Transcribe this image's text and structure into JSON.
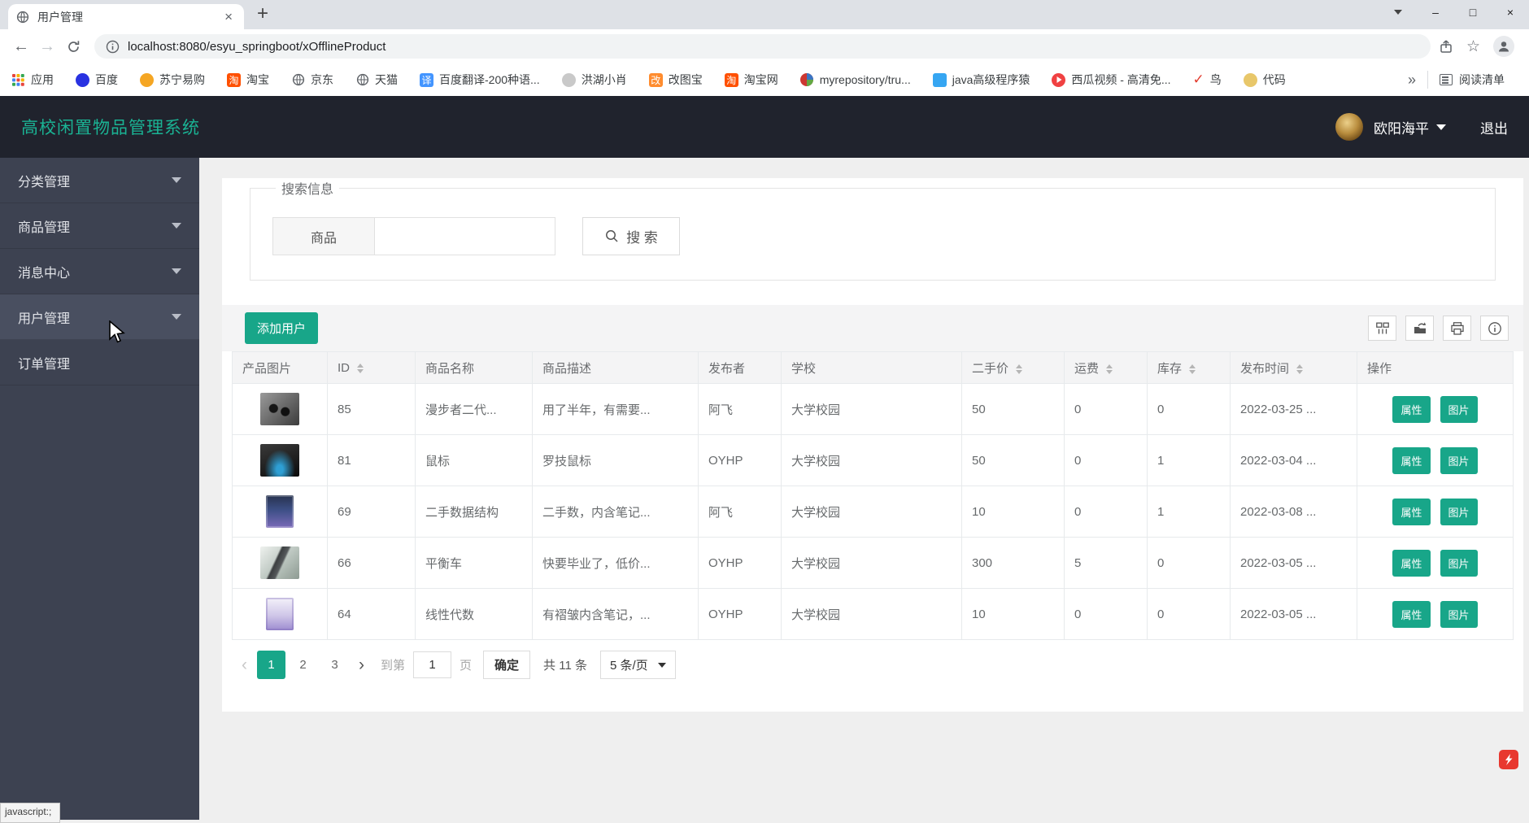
{
  "colors": {
    "accent": "#1ab394",
    "accent_dark": "#18a689",
    "header_bg": "#20232d",
    "sidebar_bg": "#3d4251",
    "sidebar_active_bg": "#494f60",
    "page_bg": "#efefef"
  },
  "browser": {
    "tab_title": "用户管理",
    "url": "localhost:8080/esyu_springboot/xOfflineProduct",
    "bookmarks": [
      {
        "label": "应用",
        "icon": "apps-grid-icon",
        "type": "grid"
      },
      {
        "label": "百度",
        "icon": "baidu-icon",
        "type": "dot",
        "color": "#2932e1"
      },
      {
        "label": "苏宁易购",
        "icon": "suning-icon",
        "type": "dot",
        "color": "#f5a623"
      },
      {
        "label": "淘宝",
        "icon": "taobao-icon",
        "type": "char",
        "color": "#ff5000",
        "glyph": "淘"
      },
      {
        "label": "京东",
        "icon": "jd-globe-icon",
        "type": "globe"
      },
      {
        "label": "天猫",
        "icon": "tmall-globe-icon",
        "type": "globe"
      },
      {
        "label": "百度翻译-200种语...",
        "icon": "baidu-translate-icon",
        "type": "char",
        "color": "#4395ff",
        "glyph": "译"
      },
      {
        "label": "洪湖小肖",
        "icon": "honghu-icon",
        "type": "dot",
        "color": "#c9c9c9"
      },
      {
        "label": "改图宝",
        "icon": "gaitubao-icon",
        "type": "char",
        "color": "#ff8c2e",
        "glyph": "改"
      },
      {
        "label": "淘宝网",
        "icon": "taobaowang-icon",
        "type": "char",
        "color": "#ff5000",
        "glyph": "淘"
      },
      {
        "label": "myrepository/tru...",
        "icon": "maven-repo-icon",
        "type": "multidot"
      },
      {
        "label": "java高级程序猿",
        "icon": "java-robot-icon",
        "type": "char",
        "color": "#36a6f2",
        "glyph": ""
      },
      {
        "label": "西瓜视频 - 高清免...",
        "icon": "xigua-video-icon",
        "type": "play",
        "color": "#f04142"
      },
      {
        "label": "鸟",
        "icon": "bird-icon",
        "type": "check",
        "color": "#e23b2e"
      },
      {
        "label": "代码",
        "icon": "code-icon",
        "type": "dot",
        "color": "#e8c76a"
      }
    ],
    "overflow_chevron": "»",
    "reading_list_label": "阅读清单"
  },
  "header": {
    "title": "高校闲置物品管理系统",
    "username": "欧阳海平",
    "logout_label": "退出"
  },
  "sidebar": {
    "items": [
      {
        "label": "分类管理",
        "chevron": true,
        "active": false
      },
      {
        "label": "商品管理",
        "chevron": true,
        "active": false
      },
      {
        "label": "消息中心",
        "chevron": true,
        "active": false
      },
      {
        "label": "用户管理",
        "chevron": true,
        "active": true
      },
      {
        "label": "订单管理",
        "chevron": false,
        "active": false
      }
    ]
  },
  "search": {
    "legend": "搜索信息",
    "field_label": "商品",
    "input_value": "",
    "button_label": "搜 索"
  },
  "toolbar": {
    "add_button_label": "添加用户"
  },
  "table": {
    "columns": [
      {
        "label": "产品图片",
        "sortable": false
      },
      {
        "label": "ID",
        "sortable": true
      },
      {
        "label": "商品名称",
        "sortable": false
      },
      {
        "label": "商品描述",
        "sortable": false
      },
      {
        "label": "发布者",
        "sortable": false
      },
      {
        "label": "学校",
        "sortable": false
      },
      {
        "label": "二手价",
        "sortable": true
      },
      {
        "label": "运费",
        "sortable": true
      },
      {
        "label": "库存",
        "sortable": true
      },
      {
        "label": "发布时间",
        "sortable": true
      },
      {
        "label": "操作",
        "sortable": false,
        "center": true
      }
    ],
    "rows": [
      {
        "image": "earbuds",
        "id": "85",
        "name": "漫步者二代...",
        "description": "用了半年，有需要...",
        "publisher": "阿飞",
        "school": "大学校园",
        "price": "50",
        "shipping": "0",
        "stock": "0",
        "publish_time": "2022-03-25 ..."
      },
      {
        "image": "mouse",
        "id": "81",
        "name": "鼠标",
        "description": "罗技鼠标",
        "publisher": "OYHP",
        "school": "大学校园",
        "price": "50",
        "shipping": "0",
        "stock": "1",
        "publish_time": "2022-03-04 ..."
      },
      {
        "image": "book-blue",
        "id": "69",
        "name": "二手数据结构",
        "description": "二手数，内含笔记...",
        "publisher": "阿飞",
        "school": "大学校园",
        "price": "10",
        "shipping": "0",
        "stock": "1",
        "publish_time": "2022-03-08 ..."
      },
      {
        "image": "scooter",
        "id": "66",
        "name": "平衡车",
        "description": "快要毕业了，低价...",
        "publisher": "OYHP",
        "school": "大学校园",
        "price": "300",
        "shipping": "5",
        "stock": "0",
        "publish_time": "2022-03-05 ..."
      },
      {
        "image": "book-purple",
        "id": "64",
        "name": "线性代数",
        "description": "有褶皱内含笔记，...",
        "publisher": "OYHP",
        "school": "大学校园",
        "price": "10",
        "shipping": "0",
        "stock": "0",
        "publish_time": "2022-03-05 ..."
      }
    ],
    "action_buttons": [
      "属性",
      "图片"
    ]
  },
  "pagination": {
    "prev": "‹",
    "pages": [
      {
        "label": "1",
        "active": true
      },
      {
        "label": "2",
        "active": false
      },
      {
        "label": "3",
        "active": false
      }
    ],
    "next": "›",
    "goto_label": "到第",
    "goto_value": "1",
    "goto_unit": "页",
    "confirm_label": "确定",
    "total_label": "共 11 条",
    "page_size_label": "5 条/页"
  },
  "status_tooltip": "javascript:;"
}
